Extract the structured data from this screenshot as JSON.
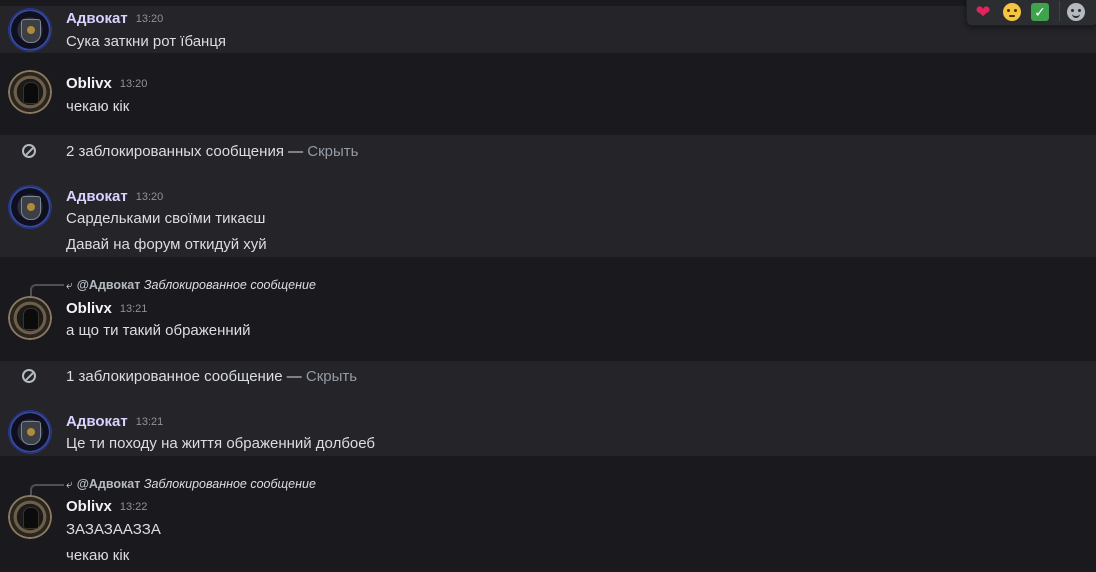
{
  "toolbar": {
    "items": [
      {
        "icon": "heart-reaction-icon",
        "color": "#e0245e"
      },
      {
        "icon": "face-reaction-icon",
        "color": "#f4c542"
      },
      {
        "icon": "check-reaction-icon",
        "color": "#3fa34d"
      },
      {
        "icon": "add-reaction-icon",
        "color": "#b5bac1"
      }
    ]
  },
  "messages": [
    {
      "author": "Адвокат",
      "time": "13:20",
      "lines": [
        "Сука заткни рот їбанця"
      ]
    },
    {
      "author": "Oblivx",
      "time": "13:20",
      "lines": [
        "чекаю кік"
      ]
    },
    {
      "blocked": "2 заблокированных сообщения — ",
      "hide": "Скрыть"
    },
    {
      "author": "Адвокат",
      "time": "13:20",
      "lines": [
        "Сардельками своїми тикаєш",
        "Давай на форум откидуй хуй"
      ]
    },
    {
      "reply_mention": "@Адвокат",
      "reply_text": "Заблокированное сообщение",
      "author": "Oblivx",
      "time": "13:21",
      "lines": [
        "а що ти такий ображенний"
      ]
    },
    {
      "blocked": "1 заблокированное сообщение — ",
      "hide": "Скрыть"
    },
    {
      "author": "Адвокат",
      "time": "13:21",
      "lines": [
        "Це ти походу на життя ображенний долбоеб"
      ]
    },
    {
      "reply_mention": "@Адвокат",
      "reply_text": "Заблокированное сообщение",
      "author": "Oblivx",
      "time": "13:22",
      "lines": [
        "ЗАЗАЗААЗЗА",
        "чекаю кік"
      ]
    }
  ],
  "colors": {
    "background": "#1a1a1e",
    "alt_background": "#242429",
    "author_advokat": "#d8d2ff",
    "author_oblivx": "#f2f3f5",
    "muted": "#949ba4"
  }
}
